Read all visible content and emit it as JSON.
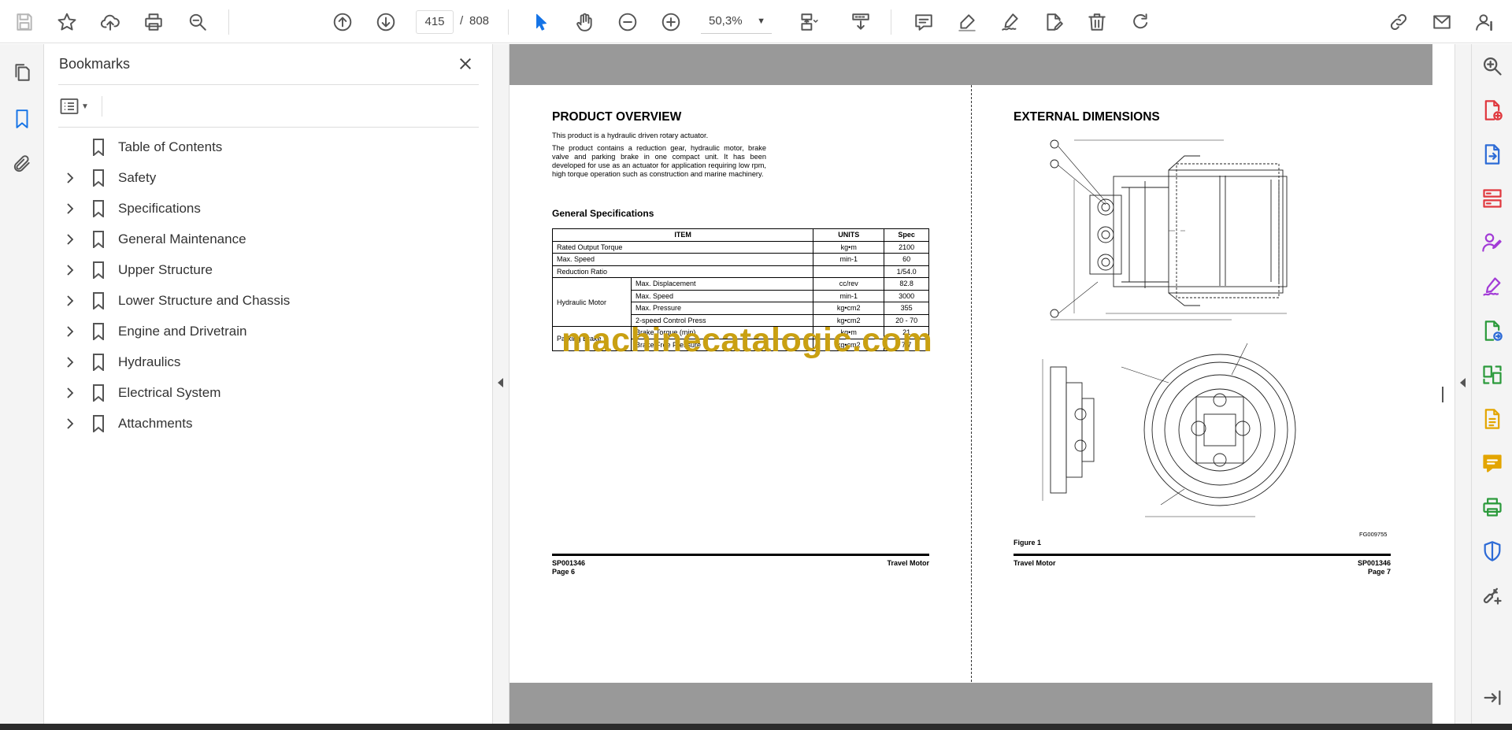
{
  "toolbar": {
    "page_current": "415",
    "page_separator": "/",
    "page_total": "808",
    "zoom_value": "50,3%"
  },
  "bookmarks_panel": {
    "title": "Bookmarks",
    "items": [
      {
        "label": "Table of Contents",
        "expandable": false
      },
      {
        "label": "Safety",
        "expandable": true
      },
      {
        "label": "Specifications",
        "expandable": true
      },
      {
        "label": "General Maintenance",
        "expandable": true
      },
      {
        "label": "Upper Structure",
        "expandable": true
      },
      {
        "label": "Lower Structure and Chassis",
        "expandable": true
      },
      {
        "label": "Engine and Drivetrain",
        "expandable": true
      },
      {
        "label": "Hydraulics",
        "expandable": true
      },
      {
        "label": "Electrical System",
        "expandable": true
      },
      {
        "label": "Attachments",
        "expandable": true
      }
    ]
  },
  "doc": {
    "left_page": {
      "title": "PRODUCT OVERVIEW",
      "para1": "This product is a hydraulic driven rotary actuator.",
      "para2": "The product contains a reduction gear, hydraulic motor, brake valve and parking brake in one compact unit. It has been developed for use as an actuator for application requiring low rpm, high torque operation such as construction and marine machinery.",
      "spec_heading": "General Specifications",
      "table": {
        "headers": [
          "ITEM",
          "UNITS",
          "Spec"
        ],
        "rows": {
          "torque": {
            "item": "Rated Output Torque",
            "unit": "kg•m",
            "spec": "2100"
          },
          "speed": {
            "item": "Max. Speed",
            "unit": "min-1",
            "spec": "60"
          },
          "ratio": {
            "item": "Reduction Ratio",
            "unit": "",
            "spec": "1/54.0"
          },
          "hm_group": "Hydraulic Motor",
          "hm_disp": {
            "item": "Max. Displacement",
            "unit": "cc/rev",
            "spec": "82.8"
          },
          "hm_speed": {
            "item": "Max. Speed",
            "unit": "min-1",
            "spec": "3000"
          },
          "hm_press": {
            "item": "Max. Pressure",
            "unit": "kg•cm2",
            "spec": "355"
          },
          "hm_ctrl": {
            "item": "2-speed Control Press",
            "unit": "kg•cm2",
            "spec": "20 - 70"
          },
          "pb_group": "Parking Brake",
          "pb_torque": {
            "item": "Brake Torque (min)",
            "unit": "kg•m",
            "spec": "21"
          },
          "pb_free": {
            "item": "Brake Free Pressure",
            "unit": "kg•cm2",
            "spec": "7.7"
          }
        }
      },
      "watermark": "machinecatalogic.com",
      "footer_left_code": "SP001346",
      "footer_left_page": "Page 6",
      "footer_right_title": "Travel Motor"
    },
    "right_page": {
      "title": "EXTERNAL DIMENSIONS",
      "figure_label": "Figure 1",
      "figure_id": "FG009755",
      "footer_left_title": "Travel Motor",
      "footer_right_code": "SP001346",
      "footer_right_page": "Page 7"
    }
  },
  "icons": {
    "top_toolbar": [
      "save-icon",
      "star-icon",
      "upload-icon",
      "print-icon",
      "zoom-search-icon",
      "arrow-up-circle-icon",
      "arrow-down-circle-icon",
      "select-cursor-icon",
      "hand-tool-icon",
      "zoom-out-icon",
      "zoom-in-icon",
      "page-fit-icon",
      "scroll-mode-icon",
      "comment-icon",
      "highlight-icon",
      "sign-icon",
      "fill-form-icon",
      "trash-icon",
      "rotate-icon",
      "share-link-icon",
      "email-icon",
      "account-icon"
    ],
    "left_rail": [
      "pages-icon",
      "bookmark-icon",
      "attachment-icon"
    ],
    "right_rail": [
      "search-zoom-icon",
      "create-pdf-icon",
      "export-pdf-icon",
      "organize-pages-icon",
      "request-signature-icon",
      "fill-sign-icon",
      "send-review-icon",
      "compare-icon",
      "edit-pdf-icon",
      "comment-icon",
      "print-production-icon",
      "protect-icon",
      "more-tools-icon",
      "expand-icon"
    ]
  },
  "colors": {
    "accent": "#1473e6",
    "watermark": "#c9a012",
    "doc_background": "#999999",
    "red_tool": "#e0383e",
    "blue_tool": "#2d6bd6",
    "purple_tool": "#a23bd6",
    "green_tool": "#2b9a3b",
    "yellow_tool": "#e3a500"
  }
}
